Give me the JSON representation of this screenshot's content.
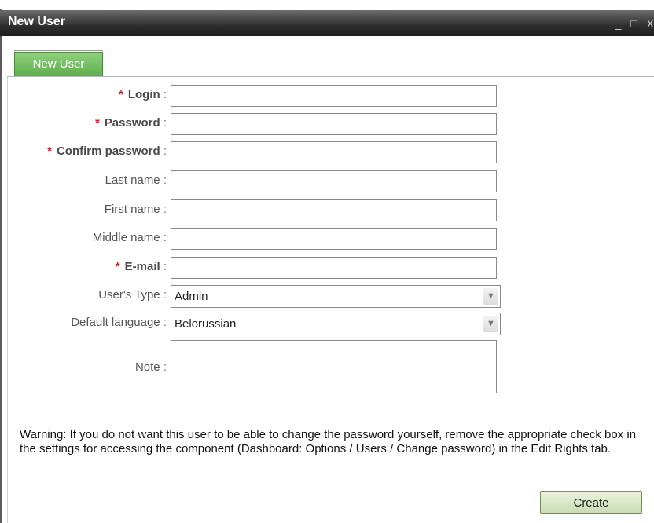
{
  "window": {
    "title": "New User",
    "controls": "_ □ X"
  },
  "tabs": [
    {
      "label": "New User",
      "active": true
    }
  ],
  "form": {
    "login_label": "Login",
    "password_label": "Password",
    "confirm_label": "Confirm password",
    "lastname_label": "Last name",
    "firstname_label": "First name",
    "middlename_label": "Middle name",
    "email_label": "E-mail",
    "usertype_label": "User's Type",
    "usertype_value": "Admin",
    "language_label": "Default language",
    "language_value": "Belorussian",
    "note_label": "Note",
    "required_mark": "*",
    "colon": ":"
  },
  "warning": "Warning: If you do not want this user to be able to change the password yourself, remove the appropriate check box in the settings for accessing the component (Dashboard: Options / Users / Change password) in the Edit Rights tab.",
  "create_label": "Create",
  "colors": {
    "tab_green": "#5eae4c",
    "required_star": "#d32020",
    "titlebar": "#2f2f2f"
  }
}
